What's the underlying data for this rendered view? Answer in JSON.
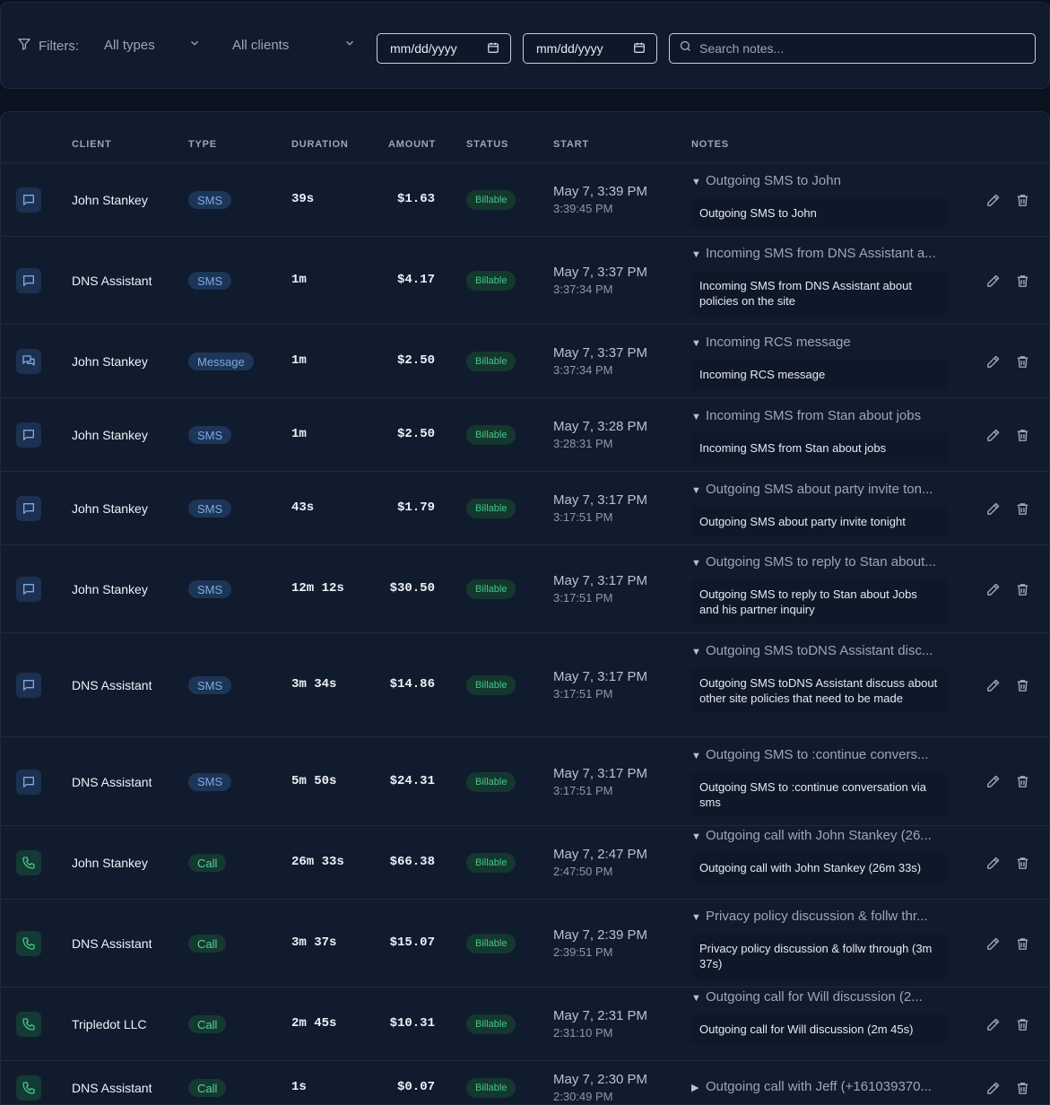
{
  "filters": {
    "label": "Filters:",
    "type_select": "All types",
    "client_select": "All clients",
    "date_from": "mm/dd/yyyy",
    "date_to": "mm/dd/yyyy",
    "search_placeholder": "Search notes..."
  },
  "table": {
    "headers": {
      "client": "CLIENT",
      "type": "TYPE",
      "duration": "DURATION",
      "amount": "AMOUNT",
      "status": "STATUS",
      "start": "START",
      "notes": "NOTES"
    },
    "rows": [
      {
        "icon": "sms-icon",
        "client": "John Stankey",
        "type": "SMS",
        "duration": "39s",
        "amount": "$1.63",
        "status": "Billable",
        "start": "May 7, 3:39 PM",
        "start_time": "3:39:45 PM",
        "note_title": "Outgoing SMS to John",
        "note_body": "Outgoing SMS to John",
        "expanded": true
      },
      {
        "icon": "sms-icon",
        "client": "DNS Assistant",
        "type": "SMS",
        "duration": "1m",
        "amount": "$4.17",
        "status": "Billable",
        "start": "May 7, 3:37 PM",
        "start_time": "3:37:34 PM",
        "note_title": "Incoming SMS from DNS Assistant a...",
        "note_body": "Incoming SMS from DNS Assistant about policies on the site",
        "expanded": true
      },
      {
        "icon": "message-icon",
        "client": "John Stankey",
        "type": "Message",
        "duration": "1m",
        "amount": "$2.50",
        "status": "Billable",
        "start": "May 7, 3:37 PM",
        "start_time": "3:37:34 PM",
        "note_title": "Incoming RCS message",
        "note_body": "Incoming RCS message",
        "expanded": true
      },
      {
        "icon": "sms-icon",
        "client": "John Stankey",
        "type": "SMS",
        "duration": "1m",
        "amount": "$2.50",
        "status": "Billable",
        "start": "May 7, 3:28 PM",
        "start_time": "3:28:31 PM",
        "note_title": "Incoming SMS from Stan about jobs",
        "note_body": "Incoming SMS from Stan about jobs",
        "expanded": true
      },
      {
        "icon": "sms-icon",
        "client": "John Stankey",
        "type": "SMS",
        "duration": "43s",
        "amount": "$1.79",
        "status": "Billable",
        "start": "May 7, 3:17 PM",
        "start_time": "3:17:51 PM",
        "note_title": "Outgoing SMS about party invite ton...",
        "note_body": "Outgoing SMS about party invite tonight",
        "expanded": true
      },
      {
        "icon": "sms-icon",
        "client": "John Stankey",
        "type": "SMS",
        "duration": "12m 12s",
        "amount": "$30.50",
        "status": "Billable",
        "start": "May 7, 3:17 PM",
        "start_time": "3:17:51 PM",
        "note_title": "Outgoing SMS to reply to Stan about...",
        "note_body": "Outgoing SMS to reply to Stan about Jobs and his partner inquiry",
        "expanded": true
      },
      {
        "icon": "sms-icon",
        "client": "DNS Assistant",
        "type": "SMS",
        "duration": "3m 34s",
        "amount": "$14.86",
        "status": "Billable",
        "start": "May 7, 3:17 PM",
        "start_time": "3:17:51 PM",
        "note_title": "Outgoing SMS toDNS Assistant disc...",
        "note_body": "Outgoing SMS toDNS Assistant discuss about other site policies that need to be made",
        "expanded": true
      },
      {
        "icon": "sms-icon",
        "client": "DNS Assistant",
        "type": "SMS",
        "duration": "5m 50s",
        "amount": "$24.31",
        "status": "Billable",
        "start": "May 7, 3:17 PM",
        "start_time": "3:17:51 PM",
        "note_title": "Outgoing SMS to :continue convers...",
        "note_body": "Outgoing SMS to :continue conversation via sms",
        "expanded": true
      },
      {
        "icon": "phone-icon",
        "client": "John Stankey",
        "type": "Call",
        "duration": "26m 33s",
        "amount": "$66.38",
        "status": "Billable",
        "start": "May 7, 2:47 PM",
        "start_time": "2:47:50 PM",
        "note_title": "Outgoing call with John Stankey (26...",
        "note_body": "Outgoing call with John Stankey  (26m 33s)",
        "expanded": true
      },
      {
        "icon": "phone-icon",
        "client": "DNS Assistant",
        "type": "Call",
        "duration": "3m 37s",
        "amount": "$15.07",
        "status": "Billable",
        "start": "May 7, 2:39 PM",
        "start_time": "2:39:51 PM",
        "note_title": "Privacy policy discussion & follw thr...",
        "note_body": "Privacy policy discussion & follw through (3m 37s)",
        "expanded": true
      },
      {
        "icon": "phone-icon",
        "client": "Tripledot LLC",
        "type": "Call",
        "duration": "2m 45s",
        "amount": "$10.31",
        "status": "Billable",
        "start": "May 7, 2:31 PM",
        "start_time": "2:31:10 PM",
        "note_title": "Outgoing call for Will discussion (2...",
        "note_body": "Outgoing call for Will discussion (2m 45s)",
        "expanded": true
      },
      {
        "icon": "phone-icon",
        "client": "DNS Assistant",
        "type": "Call",
        "duration": "1s",
        "amount": "$0.07",
        "status": "Billable",
        "start": "May 7, 2:30 PM",
        "start_time": "2:30:49 PM",
        "note_title": "Outgoing call with Jeff (+161039370...",
        "note_body": "",
        "expanded": false
      }
    ]
  }
}
